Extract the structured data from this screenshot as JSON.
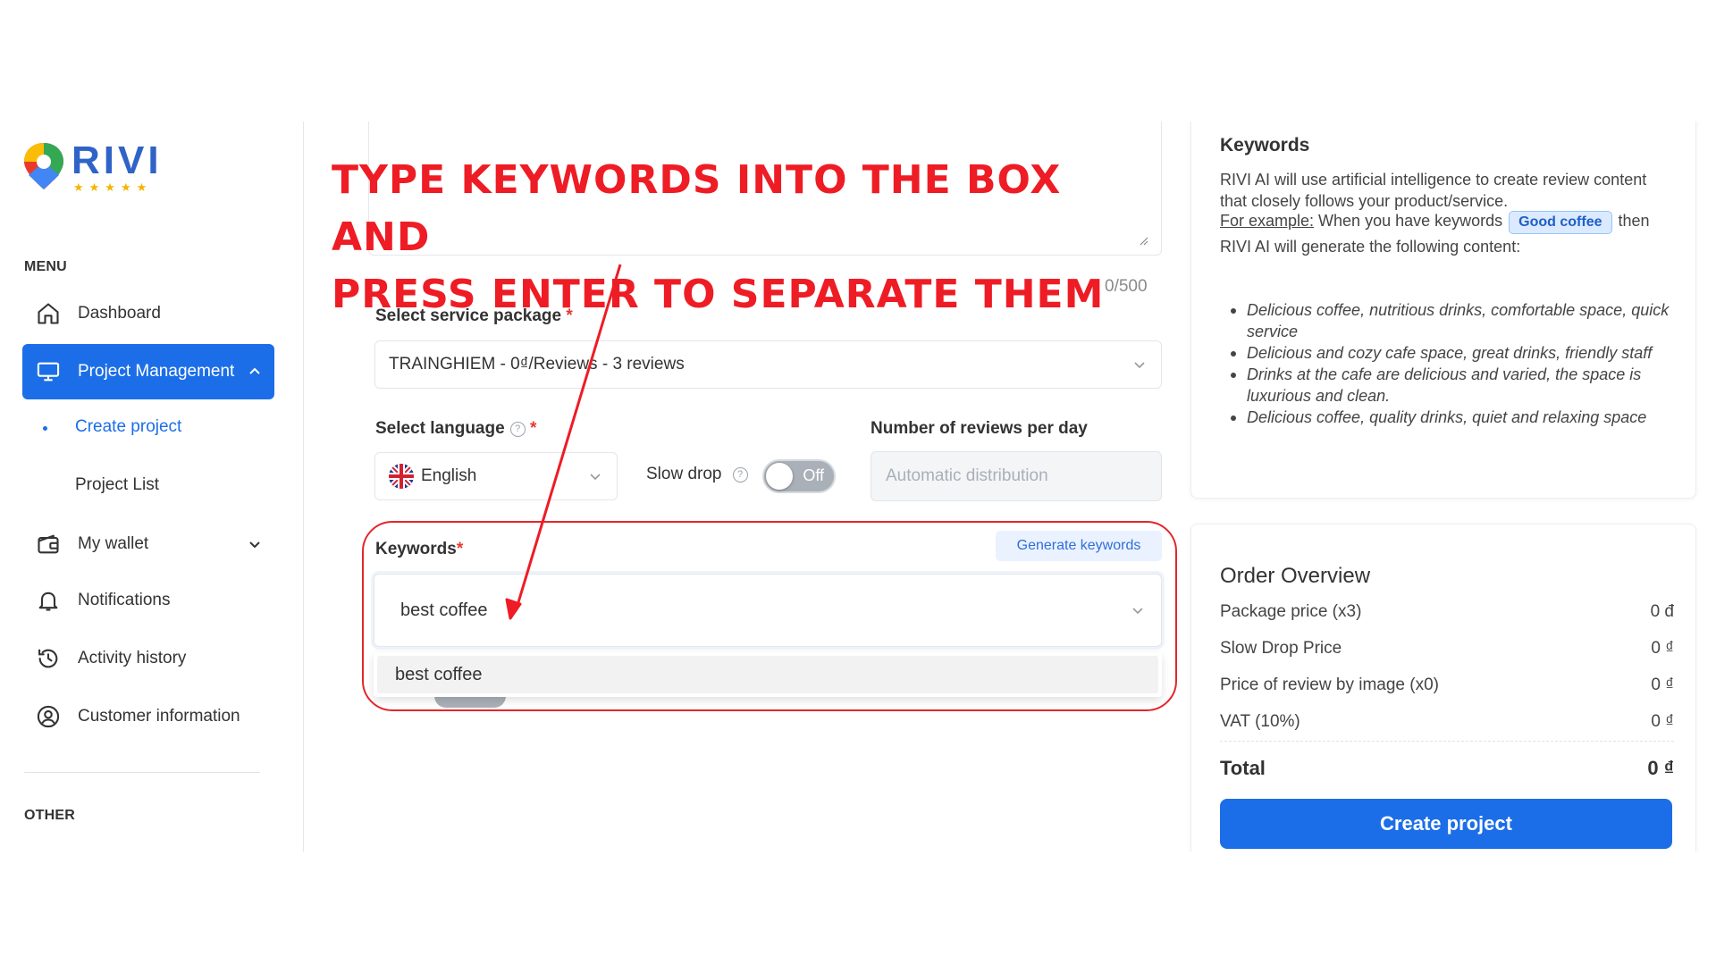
{
  "brand": {
    "name": "RIVI",
    "stars": "★★★★★"
  },
  "menu": {
    "heading": "MENU",
    "items": [
      {
        "label": "Dashboard",
        "icon": "home-icon"
      },
      {
        "label": "Project Management",
        "icon": "monitor-icon",
        "active": true
      },
      {
        "label": "My wallet",
        "icon": "wallet-icon"
      },
      {
        "label": "Notifications",
        "icon": "bell-icon"
      },
      {
        "label": "Activity history",
        "icon": "history-icon"
      },
      {
        "label": "Customer information",
        "icon": "user-circle-icon"
      }
    ],
    "subitems": [
      {
        "label": "Create project",
        "current": true
      },
      {
        "label": "Project List"
      }
    ],
    "other_heading": "OTHER"
  },
  "form": {
    "char_count": "0/500",
    "service_package": {
      "label": "Select service package",
      "required": "*",
      "value": "TRAINGHIEM - 0₫/Reviews - 3 reviews"
    },
    "language": {
      "label": "Select language",
      "help": "?",
      "required": "*",
      "value": "English"
    },
    "slow_drop": {
      "label": "Slow drop",
      "help": "?",
      "state": "Off"
    },
    "reviews_per_day": {
      "label": "Number of reviews per day",
      "placeholder": "Automatic distribution"
    },
    "keywords": {
      "label": "Keywords",
      "required": "*",
      "generate_label": "Generate keywords",
      "value": "best coffee",
      "dropdown_option": "best coffee"
    }
  },
  "overlay": {
    "instruction_line1": "TYPE KEYWORDS INTO THE BOX AND",
    "instruction_line2": "PRESS ENTER TO SEPARATE THEM"
  },
  "keywords_help": {
    "title": "Keywords",
    "intro": "RIVI AI will use artificial intelligence to create review content that closely follows your product/service.",
    "example_prefix": "For example:",
    "example_mid": " When you have keywords ",
    "example_chip": "Good coffee",
    "example_suffix": " then RIVI AI will generate the following content:",
    "examples": [
      "Delicious coffee, nutritious drinks, comfortable space, quick service",
      "Delicious and cozy cafe space, great drinks, friendly staff",
      "Drinks at the cafe are delicious and varied, the space is luxurious and clean.",
      "Delicious coffee, quality drinks, quiet and relaxing space"
    ]
  },
  "order": {
    "title": "Order Overview",
    "rows": [
      {
        "label": "Package price (x3)",
        "value": "0 đ"
      },
      {
        "label": "Slow Drop Price",
        "value": "0 ₫"
      },
      {
        "label": "Price of review by image (x0)",
        "value": "0 ₫"
      },
      {
        "label": "VAT (10%)",
        "value": "0 ₫"
      }
    ],
    "total_label": "Total",
    "total_value": "0 ₫",
    "create_label": "Create project"
  },
  "colors": {
    "primary": "#1b6ee8",
    "accent_red": "#ee1c24",
    "star": "#f5b400"
  }
}
